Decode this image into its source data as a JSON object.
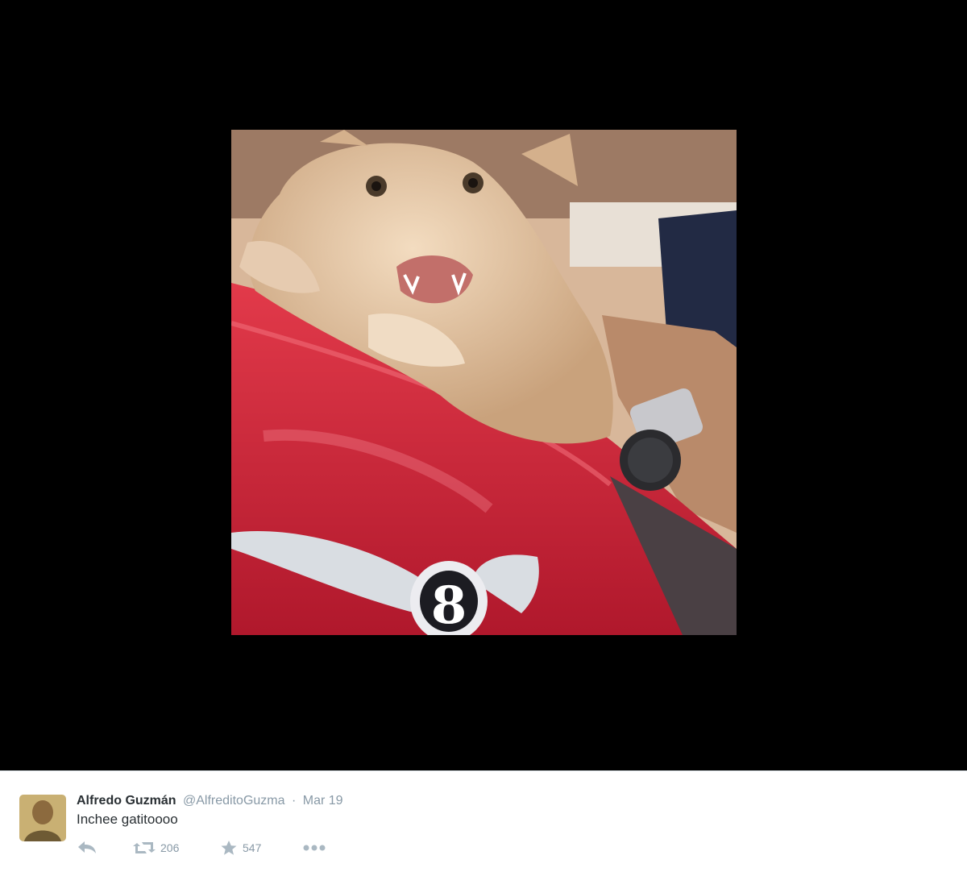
{
  "tweet": {
    "fullname": "Alfredo Guzmán",
    "username": "@AlfreditoGuzma",
    "separator": "·",
    "date": "Mar 19",
    "text": "Inchee gatitoooo",
    "retweet_count": "206",
    "favorite_count": "547"
  },
  "icons": {
    "reply": "reply-icon",
    "retweet": "retweet-icon",
    "favorite": "star-icon",
    "more": "more-icon"
  },
  "colors": {
    "media_background": "#000000",
    "action_icon": "#aab8c2",
    "muted_text": "#8899a6",
    "primary_text": "#292f33"
  }
}
